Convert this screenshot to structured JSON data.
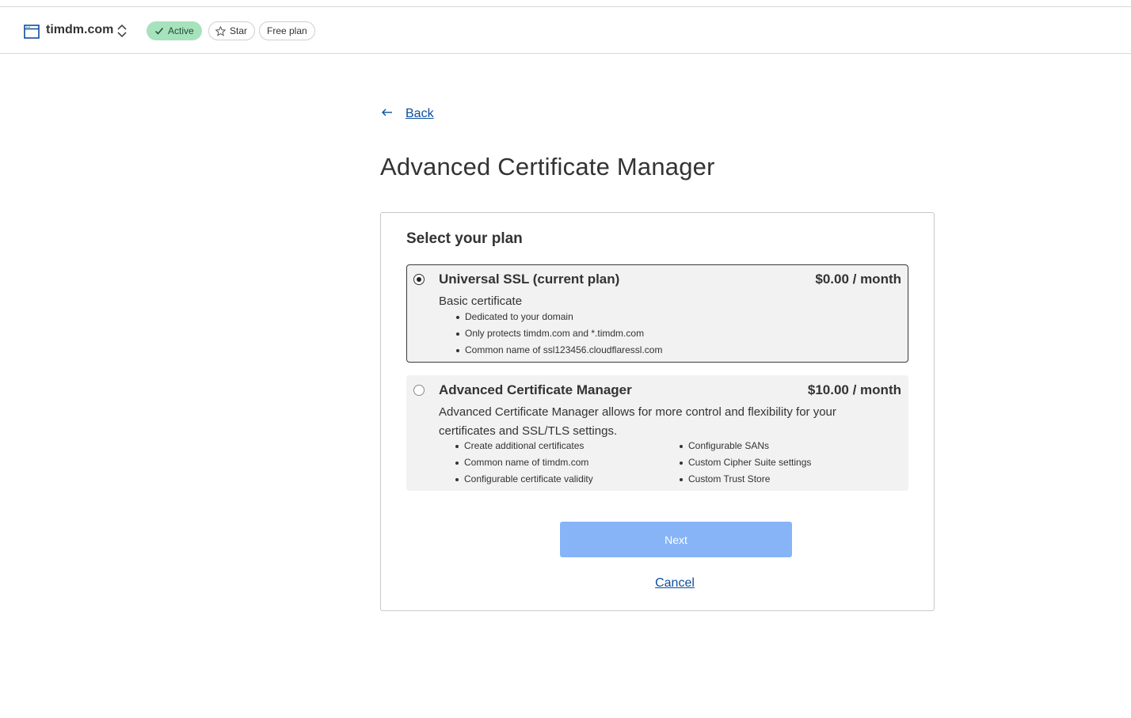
{
  "header": {
    "zone_name": "timdm.com",
    "status_badge": "Active",
    "star_label": "Star",
    "plan_badge": "Free plan"
  },
  "nav": {
    "back_label": "Back"
  },
  "page": {
    "title": "Advanced Certificate Manager"
  },
  "card": {
    "title": "Select your plan",
    "plans": [
      {
        "name": "Universal SSL (current plan)",
        "price": "$0.00 / month",
        "description": "Basic certificate",
        "selected": true,
        "features": [
          "Dedicated to your domain",
          "Only protects timdm.com and *.timdm.com",
          "Common name of ssl123456.cloudflaressl.com"
        ]
      },
      {
        "name": "Advanced Certificate Manager",
        "price": "$10.00 / month",
        "description": "Advanced Certificate Manager allows for more control and flexibility for your certificates and SSL/TLS settings.",
        "selected": false,
        "features_col1": [
          "Create additional certificates",
          "Common name of timdm.com",
          "Configurable certificate validity"
        ],
        "features_col2": [
          "Configurable SANs",
          "Custom Cipher Suite settings",
          "Custom Trust Store"
        ]
      }
    ],
    "next_label": "Next",
    "cancel_label": "Cancel"
  },
  "colors": {
    "link": "#0b4f9e",
    "active_badge_bg": "#a6e3bd",
    "next_button_bg": "#86b4f7",
    "plan_bg": "#f2f2f2"
  },
  "icons": [
    "browser-window-icon",
    "chevron-up-down-icon",
    "check-icon",
    "star-icon",
    "arrow-left-icon"
  ]
}
